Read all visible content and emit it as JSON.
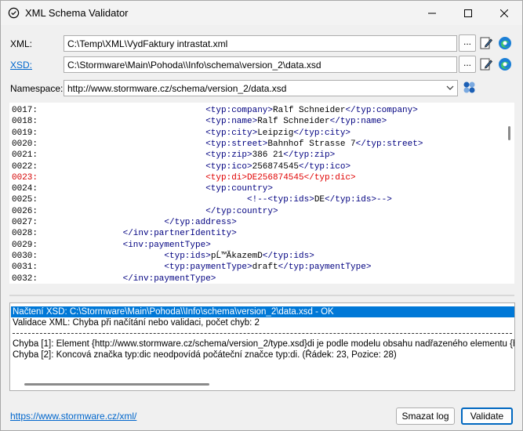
{
  "window": {
    "title": "XML Schema Validator",
    "icon": "app-icon",
    "controls": [
      "minimize-icon",
      "maximize-icon",
      "close-icon"
    ]
  },
  "form": {
    "xml_label": "XML:",
    "xml_value": "C:\\Temp\\XML\\VydFaktury intrastat.xml",
    "xsd_label": "XSD:",
    "xsd_value": "C:\\Stormware\\Main\\Pohoda\\\\Info\\schema\\version_2\\data.xsd",
    "browse_label": "...",
    "namespace_label": "Namespace:",
    "namespace_value": "http://www.stormware.cz/schema/version_2/data.xsd"
  },
  "editor": {
    "lines": [
      {
        "num": "0017:",
        "indent": 32,
        "open": "<typ:company>",
        "text": "Ralf Schneider",
        "close": "</typ:company>",
        "error": false
      },
      {
        "num": "0018:",
        "indent": 32,
        "open": "<typ:name>",
        "text": "Ralf Schneider",
        "close": "</typ:name>",
        "error": false
      },
      {
        "num": "0019:",
        "indent": 32,
        "open": "<typ:city>",
        "text": "Leipzig",
        "close": "</typ:city>",
        "error": false
      },
      {
        "num": "0020:",
        "indent": 32,
        "open": "<typ:street>",
        "text": "Bahnhof Strasse 7",
        "close": "</typ:street>",
        "error": false
      },
      {
        "num": "0021:",
        "indent": 32,
        "open": "<typ:zip>",
        "text": "386 21",
        "close": "</typ:zip>",
        "error": false
      },
      {
        "num": "0022:",
        "indent": 32,
        "open": "<typ:ico>",
        "text": "256874545",
        "close": "</typ:ico>",
        "error": false
      },
      {
        "num": "0023:",
        "indent": 32,
        "open": "<typ:di>",
        "text": "DE256874545",
        "close": "</typ:dic>",
        "error": true
      },
      {
        "num": "0024:",
        "indent": 32,
        "open": "<typ:country>",
        "text": "",
        "close": "",
        "error": false
      },
      {
        "num": "0025:",
        "indent": 40,
        "open": "<!--<typ:ids>",
        "text": "DE",
        "close": "</typ:ids>-->",
        "error": false
      },
      {
        "num": "0026:",
        "indent": 32,
        "open": "",
        "text": "",
        "close": "</typ:country>",
        "error": false
      },
      {
        "num": "0027:",
        "indent": 24,
        "open": "",
        "text": "",
        "close": "</typ:address>",
        "error": false
      },
      {
        "num": "0028:",
        "indent": 16,
        "open": "",
        "text": "",
        "close": "</inv:partnerIdentity>",
        "error": false
      },
      {
        "num": "0029:",
        "indent": 16,
        "open": "<inv:paymentType>",
        "text": "",
        "close": "",
        "error": false
      },
      {
        "num": "0030:",
        "indent": 24,
        "open": "<typ:ids>",
        "text": "pĹ™ĂkazemD",
        "close": "</typ:ids>",
        "error": false
      },
      {
        "num": "0031:",
        "indent": 24,
        "open": "<typ:paymentType>",
        "text": "draft",
        "close": "</typ:paymentType>",
        "error": false
      },
      {
        "num": "0032:",
        "indent": 16,
        "open": "",
        "text": "",
        "close": "</inv:paymentType>",
        "error": false
      }
    ]
  },
  "log": {
    "line1": "Načtení XSD: C:\\Stormware\\Main\\Pohoda\\\\Info\\schema\\version_2\\data.xsd - OK",
    "line2": "Validace XML: Chyba při načítání nebo validaci, počet chyb: 2",
    "line3": "Chyba [1]: Element {http://www.stormware.cz/schema/version_2/type.xsd}di je podle modelu obsahu nadřazeného elementu {http:",
    "line4": "Chyba [2]: Koncová značka typ:dic neodpovídá počáteční značce typ:di. (Řádek: 23, Pozice: 28)"
  },
  "footer": {
    "link": "https://www.stormware.cz/xml/",
    "clear_label": "Smazat log",
    "validate_label": "Validate"
  },
  "colors": {
    "accent": "#0078d7",
    "error": "#e00000",
    "link": "#0066cc",
    "tag": "#000080"
  }
}
